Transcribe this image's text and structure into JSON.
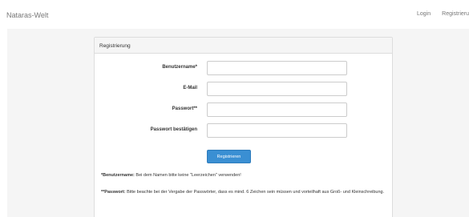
{
  "navbar": {
    "brand": "Nataras-Welt",
    "links": [
      {
        "label": "Login"
      },
      {
        "label": "Registrieru"
      }
    ]
  },
  "panel": {
    "title": "Registrierung",
    "fields": [
      {
        "label": "Benutzername*",
        "value": "",
        "placeholder": ""
      },
      {
        "label": "E-Mail",
        "value": "",
        "placeholder": ""
      },
      {
        "label": "Passwort**",
        "value": "",
        "placeholder": ""
      },
      {
        "label": "Passwort bestätigen",
        "value": "",
        "placeholder": ""
      }
    ],
    "submit_label": "Registrieren",
    "notes": [
      {
        "term": "*Benutzername:",
        "text": " Bei dem Namen bitte keine \"Leerzeichen\" verwenden!"
      },
      {
        "term": "**Passwort:",
        "text": " Bitte beachte bei der Vergabe der Passwörter, dass es mind. 6 Zeichen sein müssen und vorteilhaft aus Groß- und Kleinschreibung."
      }
    ]
  }
}
